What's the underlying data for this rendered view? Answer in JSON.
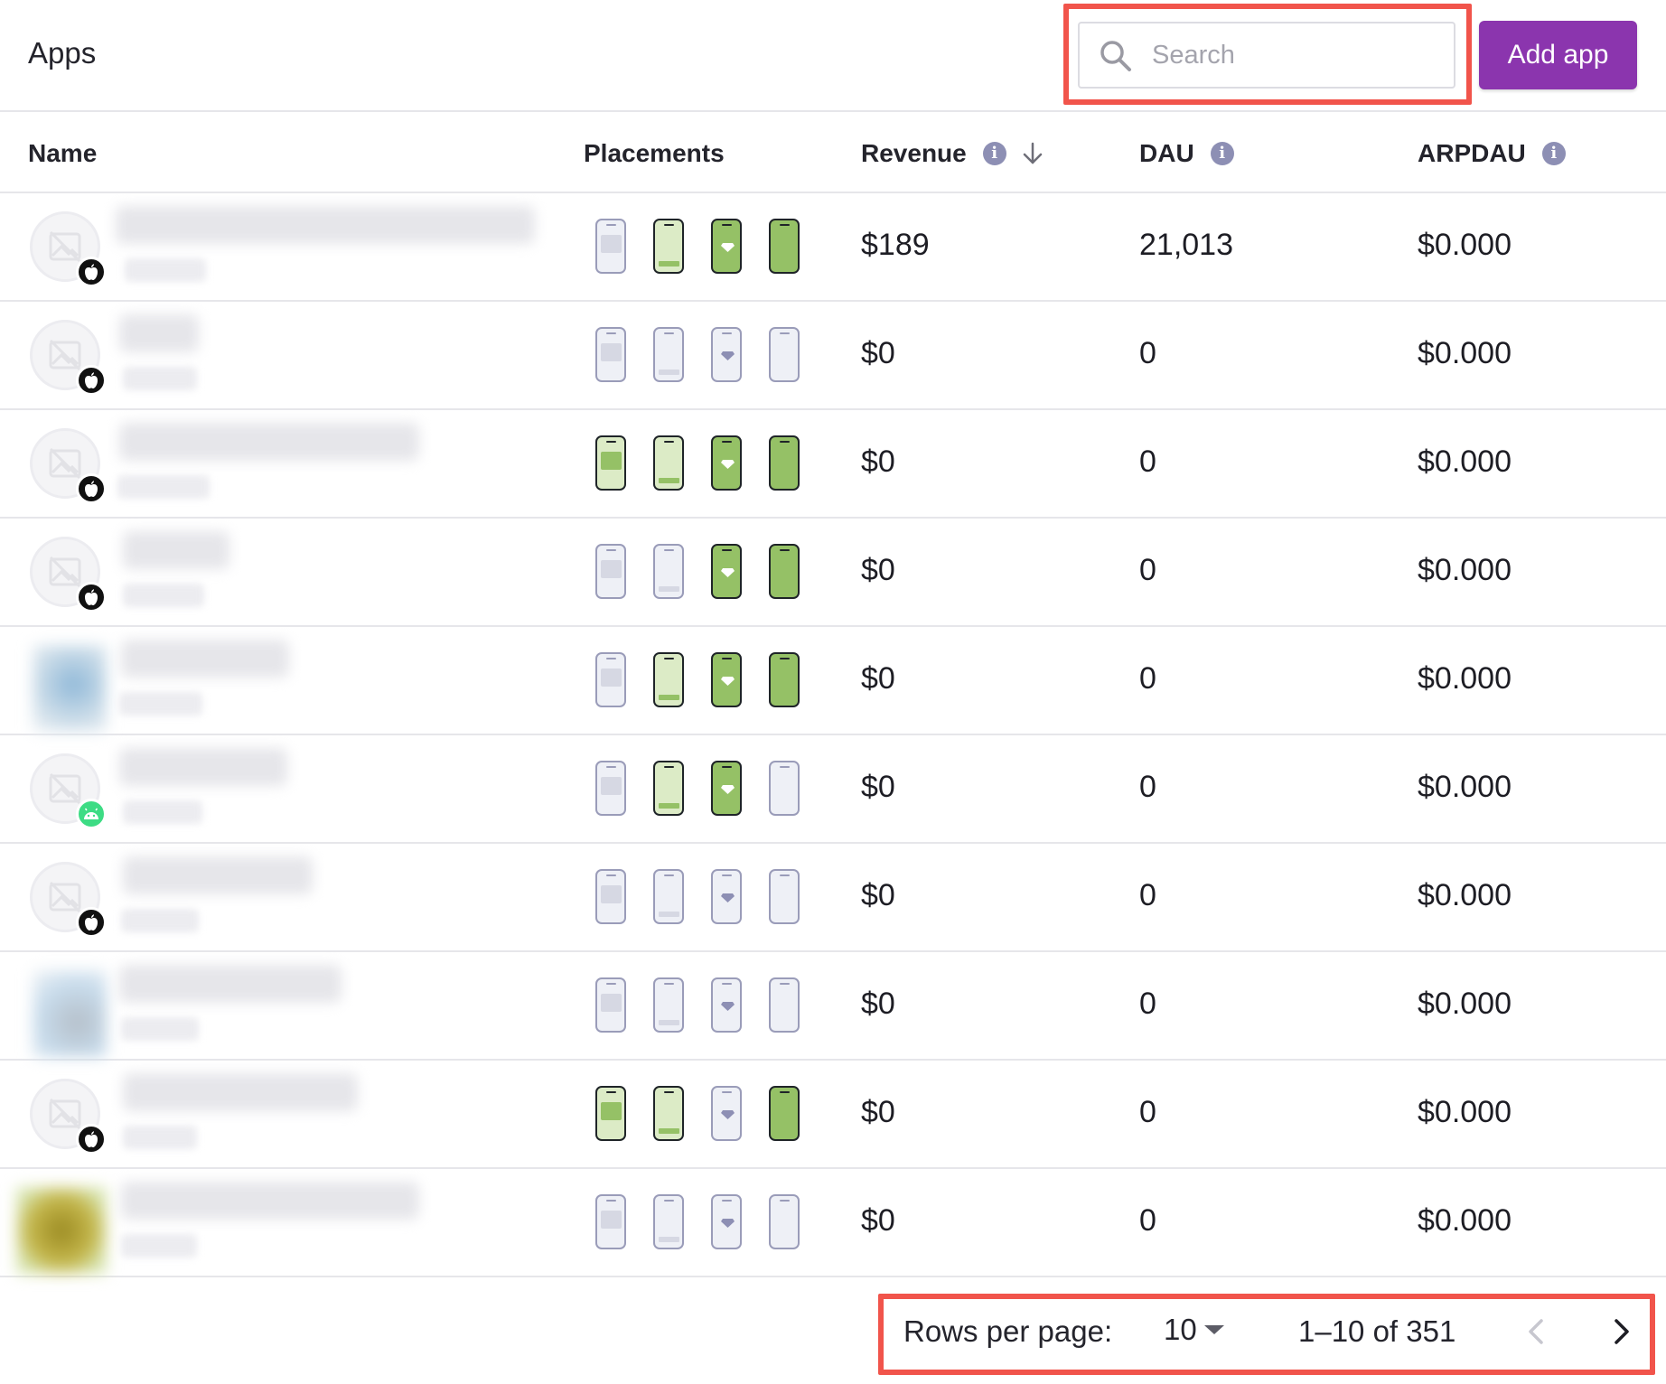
{
  "header": {
    "title": "Apps",
    "search_placeholder": "Search",
    "add_label": "Add app"
  },
  "columns": {
    "name": "Name",
    "placements": "Placements",
    "revenue": "Revenue",
    "dau": "DAU",
    "arpdau": "ARPDAU"
  },
  "rows": [
    {
      "platform": "ios",
      "placements": [
        "inactive",
        "active",
        "full-active",
        "full-active"
      ],
      "revenue": "$189",
      "dau": "21,013",
      "arpdau": "$0.000"
    },
    {
      "platform": "ios",
      "placements": [
        "inactive",
        "inactive",
        "inactive",
        "inactive"
      ],
      "revenue": "$0",
      "dau": "0",
      "arpdau": "$0.000"
    },
    {
      "platform": "ios",
      "placements": [
        "active",
        "active",
        "full-active",
        "full-active"
      ],
      "revenue": "$0",
      "dau": "0",
      "arpdau": "$0.000"
    },
    {
      "platform": "ios",
      "placements": [
        "inactive",
        "inactive",
        "full-active",
        "full-active"
      ],
      "revenue": "$0",
      "dau": "0",
      "arpdau": "$0.000"
    },
    {
      "platform": "none",
      "placements": [
        "inactive",
        "active",
        "full-active",
        "full-active"
      ],
      "revenue": "$0",
      "dau": "0",
      "arpdau": "$0.000"
    },
    {
      "platform": "android",
      "placements": [
        "inactive",
        "active",
        "full-active",
        "inactive"
      ],
      "revenue": "$0",
      "dau": "0",
      "arpdau": "$0.000"
    },
    {
      "platform": "ios",
      "placements": [
        "inactive",
        "inactive",
        "inactive",
        "inactive"
      ],
      "revenue": "$0",
      "dau": "0",
      "arpdau": "$0.000"
    },
    {
      "platform": "none",
      "placements": [
        "inactive",
        "inactive",
        "inactive",
        "inactive"
      ],
      "revenue": "$0",
      "dau": "0",
      "arpdau": "$0.000"
    },
    {
      "platform": "ios",
      "placements": [
        "active",
        "active",
        "inactive",
        "full-active"
      ],
      "revenue": "$0",
      "dau": "0",
      "arpdau": "$0.000"
    },
    {
      "platform": "none",
      "placements": [
        "inactive",
        "inactive",
        "inactive",
        "inactive"
      ],
      "revenue": "$0",
      "dau": "0",
      "arpdau": "$0.000"
    }
  ],
  "pagination": {
    "rows_per_page_label": "Rows per page:",
    "rows_per_page": "10",
    "range": "1–10 of 351"
  },
  "colors": {
    "accent": "#8b35ae",
    "placement_green": "#95c166",
    "highlight": "#f1544b",
    "android": "#3ddc84"
  }
}
